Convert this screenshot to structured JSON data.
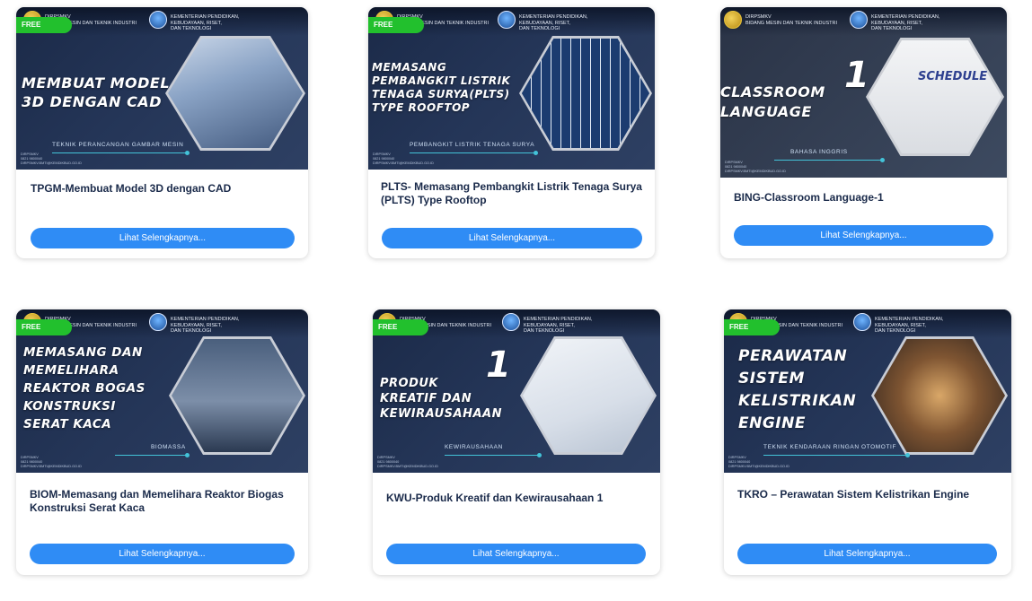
{
  "common": {
    "badge": "FREE",
    "button_label": "Lihat Selengkapnya...",
    "org_brand": "DIRPSMKV\nBIDANG MESIN DAN TEKNIK INDUSTRI",
    "ministry": "KEMENTERIAN PENDIDIKAN,\nKEBUDAYAAN, RISET,\nDAN TEKNOLOGI",
    "contact": "DIRPSMKV\n0821 9800040\nDIRPSMKV.BMTI@KEMDIKBUD.GO.ID"
  },
  "cards": [
    {
      "banner_title": "MEMBUAT MODEL\n3D DENGAN CAD",
      "subject": "TEKNIK PERANCANGAN GAMBAR MESIN",
      "title": "TPGM-Membuat Model 3D dengan CAD"
    },
    {
      "banner_title": "MEMASANG\nPEMBANGKIT LISTRIK\nTENAGA SURYA(PLTS)\nTYPE ROOFTOP",
      "subject": "PEMBANGKIT LISTRIK TENAGA SURYA",
      "title": "PLTS- Memasang Pembangkit Listrik Tenaga Surya\n(PLTS) Type Rooftop"
    },
    {
      "banner_title": "CLASSROOM\nLANGUAGE",
      "banner_number": "1",
      "banner_extra": "SCHEDULE",
      "subject": "BAHASA INGGRIS",
      "title": "BING-Classroom Language-1"
    },
    {
      "banner_title": "MEMASANG DAN\nMEMELIHARA\nREAKTOR BOGAS\nKONSTRUKSI\nSERAT KACA",
      "subject": "BIOMASSA",
      "title": "BIOM-Memasang dan Memelihara Reaktor Biogas\nKonstruksi Serat Kaca"
    },
    {
      "banner_title": "PRODUK\nKREATIF DAN\nKEWIRAUSAHAAN",
      "banner_number": "1",
      "subject": "KEWIRAUSAHAAN",
      "title": "KWU-Produk Kreatif dan Kewirausahaan 1"
    },
    {
      "banner_title": "PERAWATAN\nSISTEM\nKELISTRIKAN\nENGINE",
      "subject": "TEKNIK KENDARAAN RINGAN OTOMOTIF",
      "title": "TKRO – Perawatan Sistem Kelistrikan Engine"
    }
  ]
}
